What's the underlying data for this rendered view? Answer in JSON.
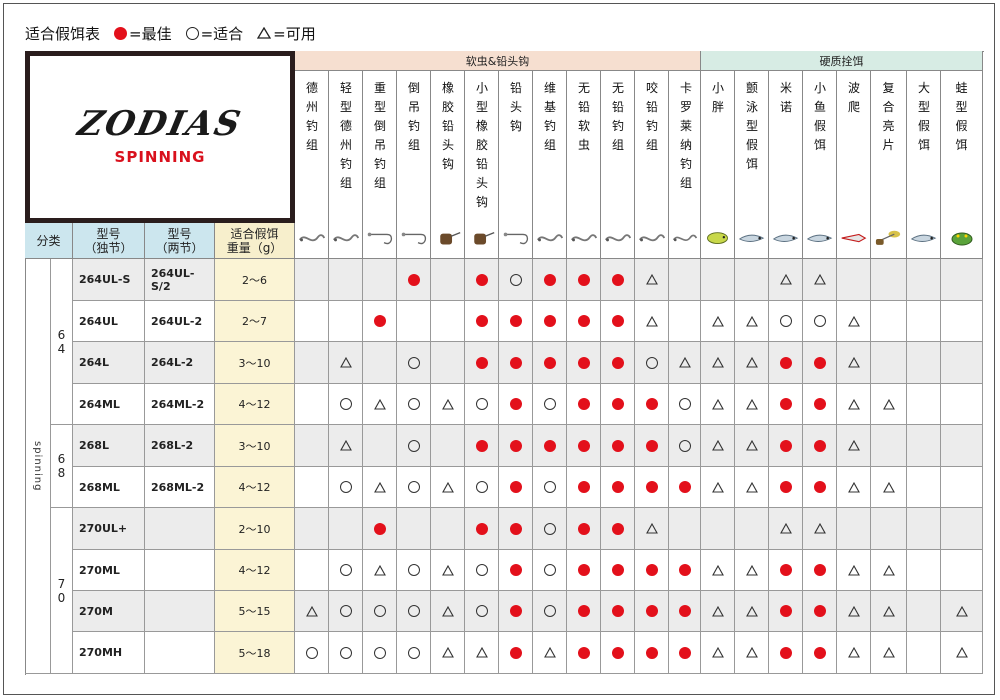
{
  "legend": {
    "title": "适合假饵表",
    "best": "=最佳",
    "good": "=适合",
    "ok": "=可用"
  },
  "logo": {
    "brand": "ZODIAS",
    "sub": "SPINNING"
  },
  "groups": {
    "soft": "软虫&铅头钩",
    "hard": "硬质拴饵"
  },
  "header": {
    "category": "分类",
    "model1": "型号\n（独节）",
    "model2": "型号\n（两节）",
    "weight": "适合假饵\n重量（g）"
  },
  "lure_columns": [
    {
      "label": "德州钓组",
      "icon": "texas-rig-icon"
    },
    {
      "label": "轻型德州钓组",
      "icon": "light-texas-rig-icon"
    },
    {
      "label": "重型倒吊钓组",
      "icon": "heavy-dropshot-rig-icon"
    },
    {
      "label": "倒吊钓组",
      "icon": "dropshot-rig-icon"
    },
    {
      "label": "橡胶铅头钩",
      "icon": "rubber-jig-icon"
    },
    {
      "label": "小型橡胶铅头钩",
      "icon": "small-rubber-jig-icon"
    },
    {
      "label": "铅头钩",
      "icon": "jighead-icon"
    },
    {
      "label": "维基钓组",
      "icon": "wacky-rig-icon"
    },
    {
      "label": "无铅软虫",
      "icon": "no-sinker-worm-icon"
    },
    {
      "label": "无铅钓组",
      "icon": "no-sinker-rig-icon"
    },
    {
      "label": "咬铅钓组",
      "icon": "split-shot-rig-icon"
    },
    {
      "label": "卡罗莱纳钓组",
      "icon": "carolina-rig-icon"
    },
    {
      "label": "小胖",
      "icon": "crankbait-icon"
    },
    {
      "label": "颤泳型假饵",
      "icon": "shad-lure-icon"
    },
    {
      "label": "米诺",
      "icon": "minnow-icon"
    },
    {
      "label": "小鱼假饵",
      "icon": "small-fish-lure-icon"
    },
    {
      "label": "波爬",
      "icon": "popper-icon"
    },
    {
      "label": "复合亮片",
      "icon": "spinnerbait-icon"
    },
    {
      "label": "大型假饵",
      "icon": "big-bait-icon"
    },
    {
      "label": "蛙型假饵",
      "icon": "frog-lure-icon"
    }
  ],
  "category_label": "spinning",
  "series": [
    {
      "code": "6\n4",
      "rows": [
        0,
        1,
        2,
        3
      ]
    },
    {
      "code": "6\n8",
      "rows": [
        4,
        5
      ]
    },
    {
      "code": "7\n0",
      "rows": [
        6,
        7,
        8,
        9
      ]
    }
  ],
  "rows": [
    {
      "model1": "264UL-S",
      "model2": "264UL-S/2",
      "weight": "2～6",
      "marks": [
        "",
        "",
        "",
        "B",
        "",
        "B",
        "G",
        "B",
        "B",
        "B",
        "O",
        "",
        "",
        "",
        "O",
        "O",
        "",
        "",
        "",
        ""
      ]
    },
    {
      "model1": "264UL",
      "model2": "264UL-2",
      "weight": "2～7",
      "marks": [
        "",
        "",
        "B",
        "",
        "",
        "B",
        "B",
        "B",
        "B",
        "B",
        "O",
        "",
        "O",
        "O",
        "G",
        "G",
        "O",
        "",
        "",
        ""
      ]
    },
    {
      "model1": "264L",
      "model2": "264L-2",
      "weight": "3～10",
      "marks": [
        "",
        "O",
        "",
        "G",
        "",
        "B",
        "B",
        "B",
        "B",
        "B",
        "G",
        "O",
        "O",
        "O",
        "B",
        "B",
        "O",
        "",
        "",
        ""
      ]
    },
    {
      "model1": "264ML",
      "model2": "264ML-2",
      "weight": "4～12",
      "marks": [
        "",
        "G",
        "O",
        "G",
        "O",
        "G",
        "B",
        "G",
        "B",
        "B",
        "B",
        "G",
        "O",
        "O",
        "B",
        "B",
        "O",
        "O",
        "",
        ""
      ]
    },
    {
      "model1": "268L",
      "model2": "268L-2",
      "weight": "3～10",
      "marks": [
        "",
        "O",
        "",
        "G",
        "",
        "B",
        "B",
        "B",
        "B",
        "B",
        "B",
        "G",
        "O",
        "O",
        "B",
        "B",
        "O",
        "",
        "",
        ""
      ]
    },
    {
      "model1": "268ML",
      "model2": "268ML-2",
      "weight": "4～12",
      "marks": [
        "",
        "G",
        "O",
        "G",
        "O",
        "G",
        "B",
        "G",
        "B",
        "B",
        "B",
        "B",
        "O",
        "O",
        "B",
        "B",
        "O",
        "O",
        "",
        ""
      ]
    },
    {
      "model1": "270UL+",
      "model2": "",
      "weight": "2～10",
      "marks": [
        "",
        "",
        "B",
        "",
        "",
        "B",
        "B",
        "G",
        "B",
        "B",
        "O",
        "",
        "",
        "",
        "O",
        "O",
        "",
        "",
        "",
        ""
      ]
    },
    {
      "model1": "270ML",
      "model2": "",
      "weight": "4～12",
      "marks": [
        "",
        "G",
        "O",
        "G",
        "O",
        "G",
        "B",
        "G",
        "B",
        "B",
        "B",
        "B",
        "O",
        "O",
        "B",
        "B",
        "O",
        "O",
        "",
        ""
      ]
    },
    {
      "model1": "270M",
      "model2": "",
      "weight": "5～15",
      "marks": [
        "O",
        "G",
        "G",
        "G",
        "O",
        "G",
        "B",
        "G",
        "B",
        "B",
        "B",
        "B",
        "O",
        "O",
        "B",
        "B",
        "O",
        "O",
        "",
        "O"
      ]
    },
    {
      "model1": "270MH",
      "model2": "",
      "weight": "5～18",
      "marks": [
        "G",
        "G",
        "G",
        "G",
        "O",
        "O",
        "B",
        "O",
        "B",
        "B",
        "B",
        "B",
        "O",
        "O",
        "B",
        "B",
        "O",
        "O",
        "",
        "O"
      ]
    }
  ],
  "shaded_rows": [
    0,
    2,
    4,
    6,
    8
  ],
  "colors": {
    "best": "#e3101b",
    "soft_header": "#f6dfd0",
    "hard_header": "#d7ece4",
    "weight_bg": "#fbf4d5",
    "row_shade": "#ececec"
  }
}
